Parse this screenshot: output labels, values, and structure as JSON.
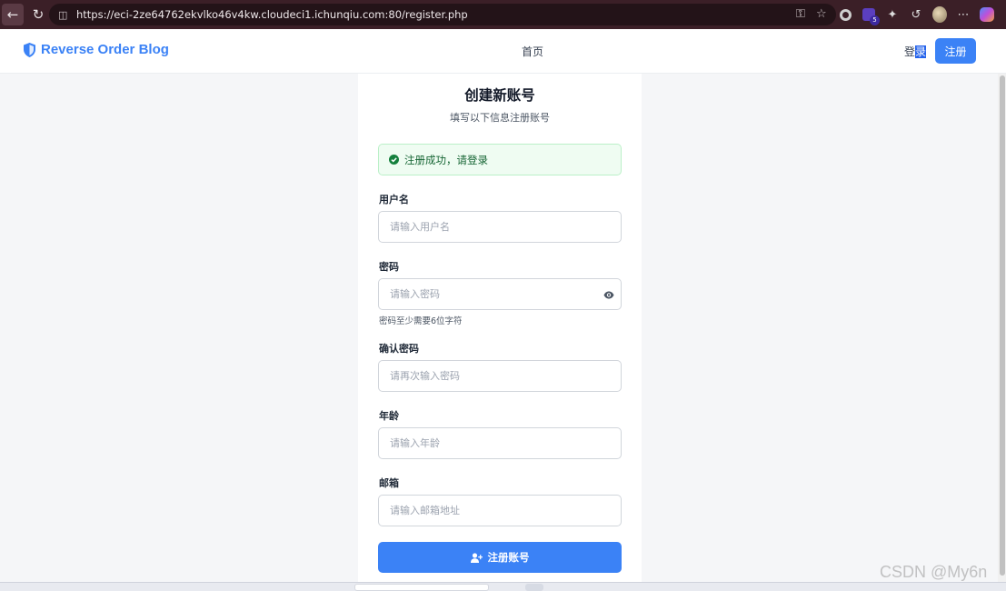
{
  "browser": {
    "url": "https://eci-2ze64762ekvlko46v4kw.cloudeci1.ichunqiu.com:80/register.php",
    "extension_badge": "5"
  },
  "navbar": {
    "brand": "Reverse Order Blog",
    "home_link": "首页",
    "login_link_part1": "登",
    "login_link_part2": "录",
    "register_button": "注册"
  },
  "form": {
    "title": "创建新账号",
    "subtitle": "填写以下信息注册账号",
    "success_message": "注册成功，请登录",
    "fields": {
      "username": {
        "label": "用户名",
        "placeholder": "请输入用户名"
      },
      "password": {
        "label": "密码",
        "placeholder": "请输入密码",
        "hint": "密码至少需要6位字符"
      },
      "confirm_password": {
        "label": "确认密码",
        "placeholder": "请再次输入密码"
      },
      "age": {
        "label": "年龄",
        "placeholder": "请输入年龄"
      },
      "email": {
        "label": "邮箱",
        "placeholder": "请输入邮箱地址"
      }
    },
    "submit_label": "注册账号"
  },
  "watermark": "CSDN @My6n",
  "colors": {
    "accent": "#3b82f6",
    "success_bg": "#effcf2",
    "success_text": "#166534",
    "browser_chrome": "#3b1f27"
  }
}
